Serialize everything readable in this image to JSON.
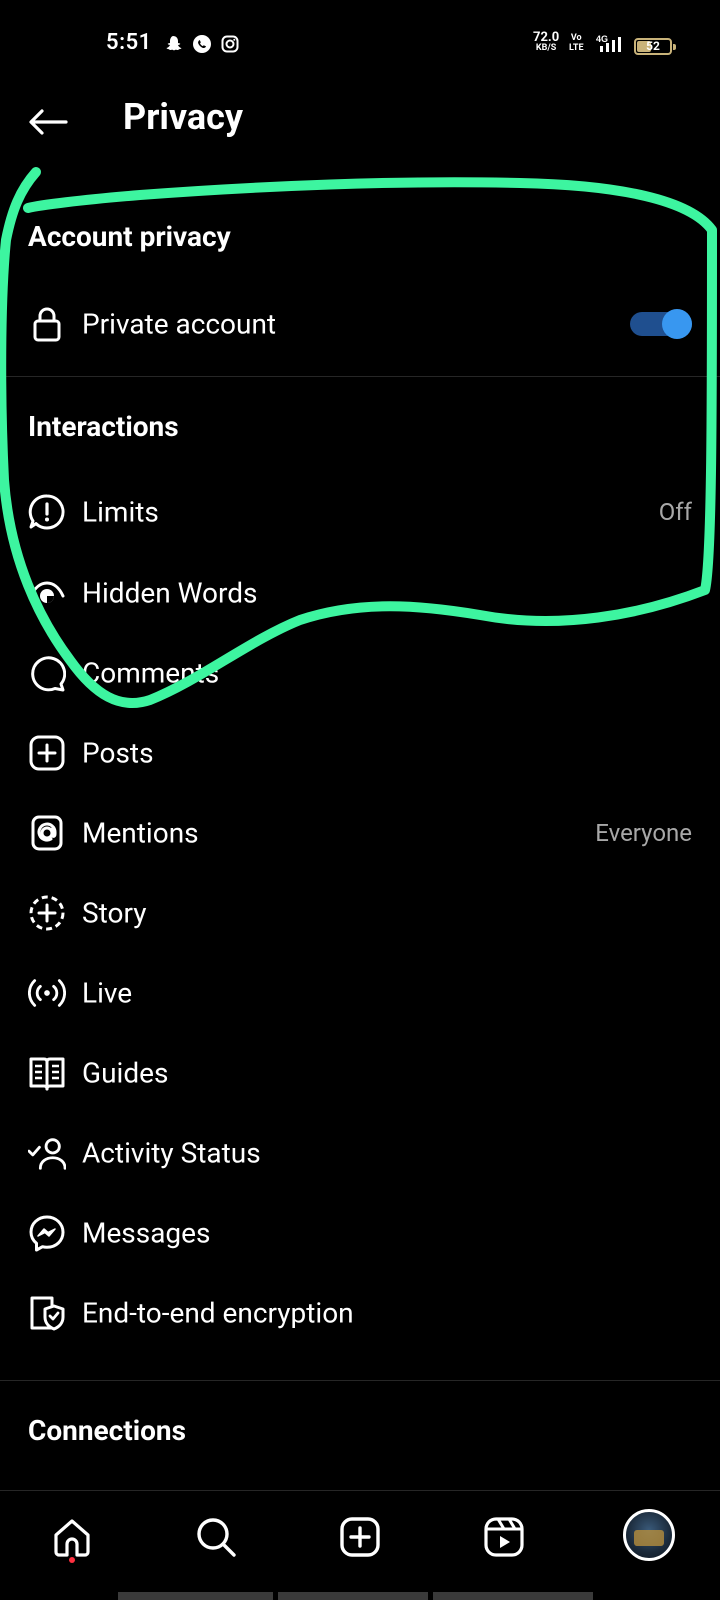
{
  "status_bar": {
    "time": "5:51",
    "network_speed": "72.0",
    "network_speed_unit": "KB/S",
    "volte_top": "Vo",
    "volte_bottom": "LTE",
    "network_type": "4G",
    "battery": "52"
  },
  "header": {
    "title": "Privacy"
  },
  "sections": {
    "account_privacy": {
      "title": "Account privacy",
      "private_account_label": "Private account",
      "private_account_enabled": true
    },
    "interactions": {
      "title": "Interactions",
      "items": [
        {
          "label": "Limits",
          "value": "Off",
          "icon": "limits-icon"
        },
        {
          "label": "Hidden Words",
          "value": "",
          "icon": "hidden-words-icon"
        },
        {
          "label": "Comments",
          "value": "",
          "icon": "comment-icon"
        },
        {
          "label": "Posts",
          "value": "",
          "icon": "plus-square-icon"
        },
        {
          "label": "Mentions",
          "value": "Everyone",
          "icon": "at-icon"
        },
        {
          "label": "Story",
          "value": "",
          "icon": "story-add-icon"
        },
        {
          "label": "Live",
          "value": "",
          "icon": "live-icon"
        },
        {
          "label": "Guides",
          "value": "",
          "icon": "guides-icon"
        },
        {
          "label": "Activity Status",
          "value": "",
          "icon": "activity-status-icon"
        },
        {
          "label": "Messages",
          "value": "",
          "icon": "messenger-icon"
        },
        {
          "label": "End-to-end encryption",
          "value": "",
          "icon": "shield-lock-icon"
        }
      ]
    },
    "connections": {
      "title": "Connections"
    }
  },
  "bottom_nav": {
    "items": [
      "home-icon",
      "search-icon",
      "create-icon",
      "reels-icon",
      "profile-avatar"
    ]
  },
  "colors": {
    "background": "#000000",
    "text_primary": "#ffffff",
    "text_secondary": "#a8a8a8",
    "toggle_knob": "#3897f0",
    "toggle_track": "#1f4f8f",
    "annotation_stroke": "#3df5a0",
    "notification_dot": "#ff3040"
  }
}
